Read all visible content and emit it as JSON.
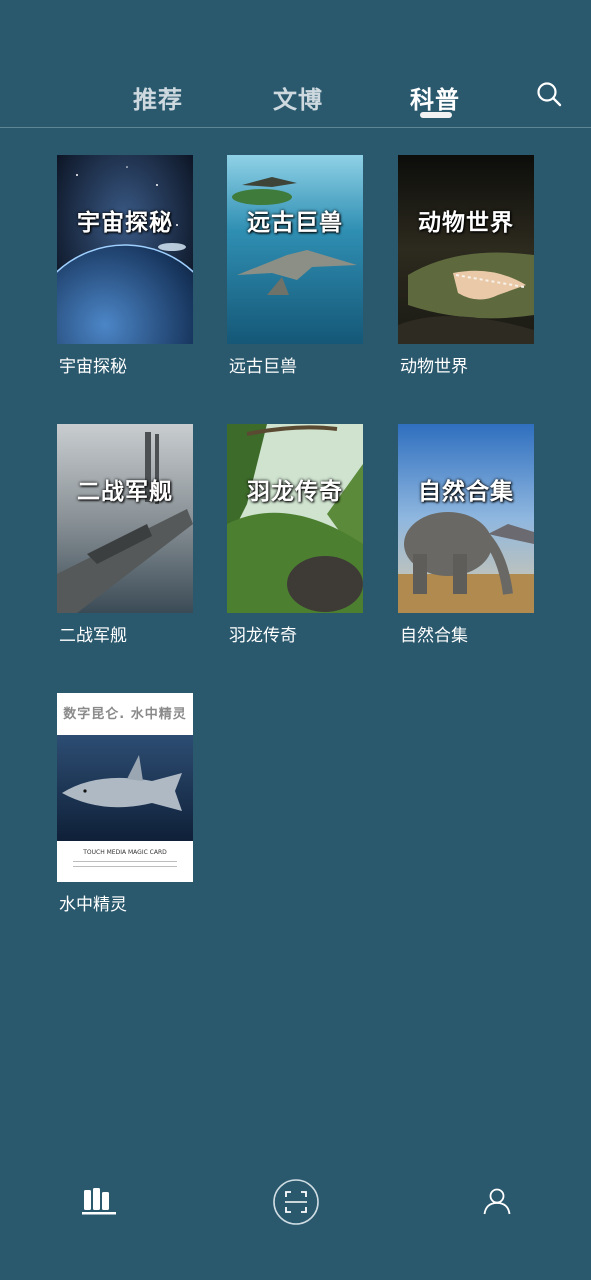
{
  "header": {
    "tabs": [
      {
        "label": "推荐",
        "active": false
      },
      {
        "label": "文博",
        "active": false
      },
      {
        "label": "科普",
        "active": true
      }
    ],
    "search_icon": "search-icon"
  },
  "books": [
    {
      "label": "宇宙探秘",
      "cover_title": "宇宙探秘"
    },
    {
      "label": "远古巨兽",
      "cover_title": "远古巨兽"
    },
    {
      "label": "动物世界",
      "cover_title": "动物世界"
    },
    {
      "label": "二战军舰",
      "cover_title": "二战军舰"
    },
    {
      "label": "羽龙传奇",
      "cover_title": "羽龙传奇"
    },
    {
      "label": "自然合集",
      "cover_title": "自然合集"
    },
    {
      "label": "水中精灵",
      "cover_title": "数字昆仑. 水中精灵",
      "cover_footer": "TOUCH MEDIA MAGIC CARD"
    }
  ],
  "bottom_nav": {
    "items": [
      {
        "icon": "bookshelf-icon",
        "active": true
      },
      {
        "icon": "scan-icon",
        "active": false
      },
      {
        "icon": "user-icon",
        "active": false
      }
    ]
  },
  "colors": {
    "background": "#2a586d",
    "tab_inactive": "#cdd9df",
    "tab_active": "#ffffff"
  }
}
